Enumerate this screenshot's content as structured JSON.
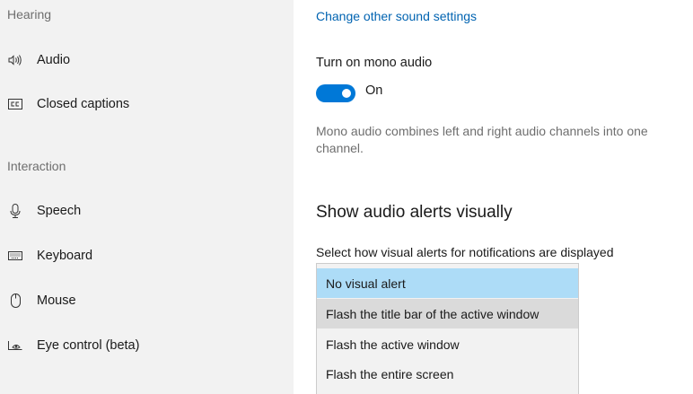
{
  "sidebar": {
    "sections": [
      {
        "header": "Hearing",
        "items": [
          {
            "label": "Audio",
            "icon": "speaker-icon"
          },
          {
            "label": "Closed captions",
            "icon": "closed-captions-icon"
          }
        ]
      },
      {
        "header": "Interaction",
        "items": [
          {
            "label": "Speech",
            "icon": "microphone-icon"
          },
          {
            "label": "Keyboard",
            "icon": "keyboard-icon"
          },
          {
            "label": "Mouse",
            "icon": "mouse-icon"
          },
          {
            "label": "Eye control (beta)",
            "icon": "eye-control-icon"
          }
        ]
      }
    ]
  },
  "main": {
    "link": "Change other sound settings",
    "mono": {
      "label": "Turn on mono audio",
      "state": "On",
      "description": "Mono audio combines left and right audio channels into one channel."
    },
    "alerts": {
      "heading": "Show audio alerts visually",
      "select_label": "Select how visual alerts for notifications are displayed",
      "options": [
        "No visual alert",
        "Flash the title bar of the active window",
        "Flash the active window",
        "Flash the entire screen"
      ],
      "selected": "No visual alert"
    }
  },
  "colors": {
    "accent": "#0078d7",
    "link": "#0063b1",
    "selected_option": "#addcf7",
    "hover_option": "#dadada",
    "sidebar_bg": "#f2f2f2"
  }
}
